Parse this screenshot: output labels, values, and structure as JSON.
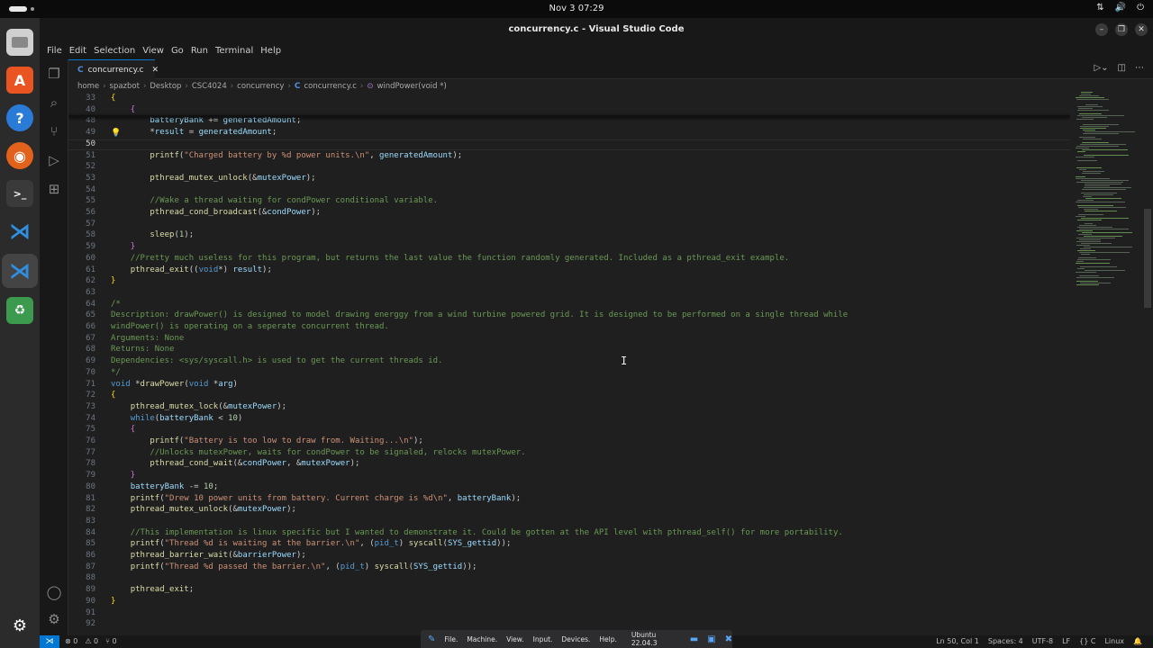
{
  "topbar": {
    "clock": "Nov 3  07:29",
    "tray": [
      "⇅",
      "🔊",
      "⏻"
    ]
  },
  "window": {
    "title": "concurrency.c - Visual Studio Code",
    "buttons": [
      "–",
      "❐",
      "✕"
    ]
  },
  "menu": [
    "File",
    "Edit",
    "Selection",
    "View",
    "Go",
    "Run",
    "Terminal",
    "Help"
  ],
  "tab": {
    "label": "concurrency.c",
    "icon": "C",
    "close": "✕"
  },
  "breadcrumb": [
    "home",
    "spazbot",
    "Desktop",
    "CSC4024",
    "concurrency",
    "concurrency.c",
    "windPower(void *)"
  ],
  "editor": {
    "current_line": "50",
    "lines": [
      {
        "n": "33",
        "html": "<span class='br0'>{</span>"
      },
      {
        "n": "40",
        "html": "    <span class='br1'>{</span>"
      },
      {
        "n": "48",
        "html": "        <span class='var'>batteryBank</span> += <span class='var'>generatedAmount</span>;"
      },
      {
        "n": "49",
        "html": "        *<span class='var'>result</span> = <span class='var'>generatedAmount</span>;"
      },
      {
        "n": "50",
        "html": ""
      },
      {
        "n": "51",
        "html": "        <span class='fn'>printf</span>(<span class='str'>\"Charged battery by %d power units.\\n\"</span>, <span class='var'>generatedAmount</span>);"
      },
      {
        "n": "52",
        "html": ""
      },
      {
        "n": "53",
        "html": "        <span class='fn'>pthread_mutex_unlock</span>(&amp;<span class='var'>mutexPower</span>);"
      },
      {
        "n": "54",
        "html": ""
      },
      {
        "n": "55",
        "html": "        <span class='cm'>//Wake a thread waiting for condPower conditional variable.</span>"
      },
      {
        "n": "56",
        "html": "        <span class='fn'>pthread_cond_broadcast</span>(&amp;<span class='var'>condPower</span>);"
      },
      {
        "n": "57",
        "html": ""
      },
      {
        "n": "58",
        "html": "        <span class='fn'>sleep</span>(<span class='num'>1</span>);"
      },
      {
        "n": "59",
        "html": "    <span class='br1'>}</span>"
      },
      {
        "n": "60",
        "html": "    <span class='cm'>//Pretty much useless for this program, but returns the last value the function randomly generated. Included as a pthread_exit example.</span>"
      },
      {
        "n": "61",
        "html": "    <span class='fn'>pthread_exit</span>((<span class='kw'>void</span>*) <span class='var'>result</span>);"
      },
      {
        "n": "62",
        "html": "<span class='br0'>}</span>"
      },
      {
        "n": "63",
        "html": ""
      },
      {
        "n": "64",
        "html": "<span class='cm'>/*</span>"
      },
      {
        "n": "65",
        "html": "<span class='cm'>Description: drawPower() is designed to model drawing energgy from a wind turbine powered grid. It is designed to be performed on a single thread while</span>"
      },
      {
        "n": "66",
        "html": "<span class='cm'>windPower() is operating on a seperate concurrent thread.</span>"
      },
      {
        "n": "67",
        "html": "<span class='cm'>Arguments: None</span>"
      },
      {
        "n": "68",
        "html": "<span class='cm'>Returns: None</span>"
      },
      {
        "n": "69",
        "html": "<span class='cm'>Dependencies: &lt;sys/syscall.h&gt; is used to get the current threads id.</span>"
      },
      {
        "n": "70",
        "html": "<span class='cm'>*/</span>"
      },
      {
        "n": "71",
        "html": "<span class='kw'>void</span> *<span class='fn'>drawPower</span>(<span class='kw'>void</span> *<span class='var'>arg</span>)"
      },
      {
        "n": "72",
        "html": "<span class='br0'>{</span>"
      },
      {
        "n": "73",
        "html": "    <span class='fn'>pthread_mutex_lock</span>(&amp;<span class='var'>mutexPower</span>);"
      },
      {
        "n": "74",
        "html": "    <span class='kw'>while</span>(<span class='var'>batteryBank</span> &lt; <span class='num'>10</span>)"
      },
      {
        "n": "75",
        "html": "    <span class='br1'>{</span>"
      },
      {
        "n": "76",
        "html": "        <span class='fn'>printf</span>(<span class='str'>\"Battery is too low to draw from. Waiting...\\n\"</span>);"
      },
      {
        "n": "77",
        "html": "        <span class='cm'>//Unlocks mutexPower, waits for condPower to be signaled, relocks mutexPower.</span>"
      },
      {
        "n": "78",
        "html": "        <span class='fn'>pthread_cond_wait</span>(&amp;<span class='var'>condPower</span>, &amp;<span class='var'>mutexPower</span>);"
      },
      {
        "n": "79",
        "html": "    <span class='br1'>}</span>"
      },
      {
        "n": "80",
        "html": "    <span class='var'>batteryBank</span> -= <span class='num'>10</span>;"
      },
      {
        "n": "81",
        "html": "    <span class='fn'>printf</span>(<span class='str'>\"Drew 10 power units from battery. Current charge is %d\\n\"</span>, <span class='var'>batteryBank</span>);"
      },
      {
        "n": "82",
        "html": "    <span class='fn'>pthread_mutex_unlock</span>(&amp;<span class='var'>mutexPower</span>);"
      },
      {
        "n": "83",
        "html": ""
      },
      {
        "n": "84",
        "html": "    <span class='cm'>//This implementation is linux specific but I wanted to demonstrate it. Could be gotten at the API level with pthread_self() for more portability.</span>"
      },
      {
        "n": "85",
        "html": "    <span class='fn'>printf</span>(<span class='str'>\"Thread %d is waiting at the barrier.\\n\"</span>, (<span class='kw'>pid_t</span>) <span class='fn'>syscall</span>(<span class='var'>SYS_gettid</span>));"
      },
      {
        "n": "86",
        "html": "    <span class='fn'>pthread_barrier_wait</span>(&amp;<span class='var'>barrierPower</span>);"
      },
      {
        "n": "87",
        "html": "    <span class='fn'>printf</span>(<span class='str'>\"Thread %d passed the barrier.\\n\"</span>, (<span class='kw'>pid_t</span>) <span class='fn'>syscall</span>(<span class='var'>SYS_gettid</span>));"
      },
      {
        "n": "88",
        "html": ""
      },
      {
        "n": "89",
        "html": "    <span class='fn'>pthread_exit</span>;"
      },
      {
        "n": "90",
        "html": "<span class='br0'>}</span>"
      },
      {
        "n": "91",
        "html": ""
      },
      {
        "n": "92",
        "html": ""
      }
    ]
  },
  "status": {
    "errors": "⊗ 0",
    "warnings": "⚠ 0",
    "ports": "⑂ 0",
    "position": "Ln 50, Col 1",
    "spaces": "Spaces: 4",
    "encoding": "UTF-8",
    "eol": "LF",
    "language": "{} C",
    "os": "Linux"
  },
  "vbox": {
    "items": [
      "File.",
      "Machine.",
      "View.",
      "Input.",
      "Devices.",
      "Help."
    ],
    "vm": "Ubuntu 22.04.3"
  },
  "colors": {
    "accent": "#0078d4",
    "background": "#1f1f1f",
    "comment": "#6a9955",
    "keyword": "#569cd6",
    "function": "#dcdcaa"
  }
}
